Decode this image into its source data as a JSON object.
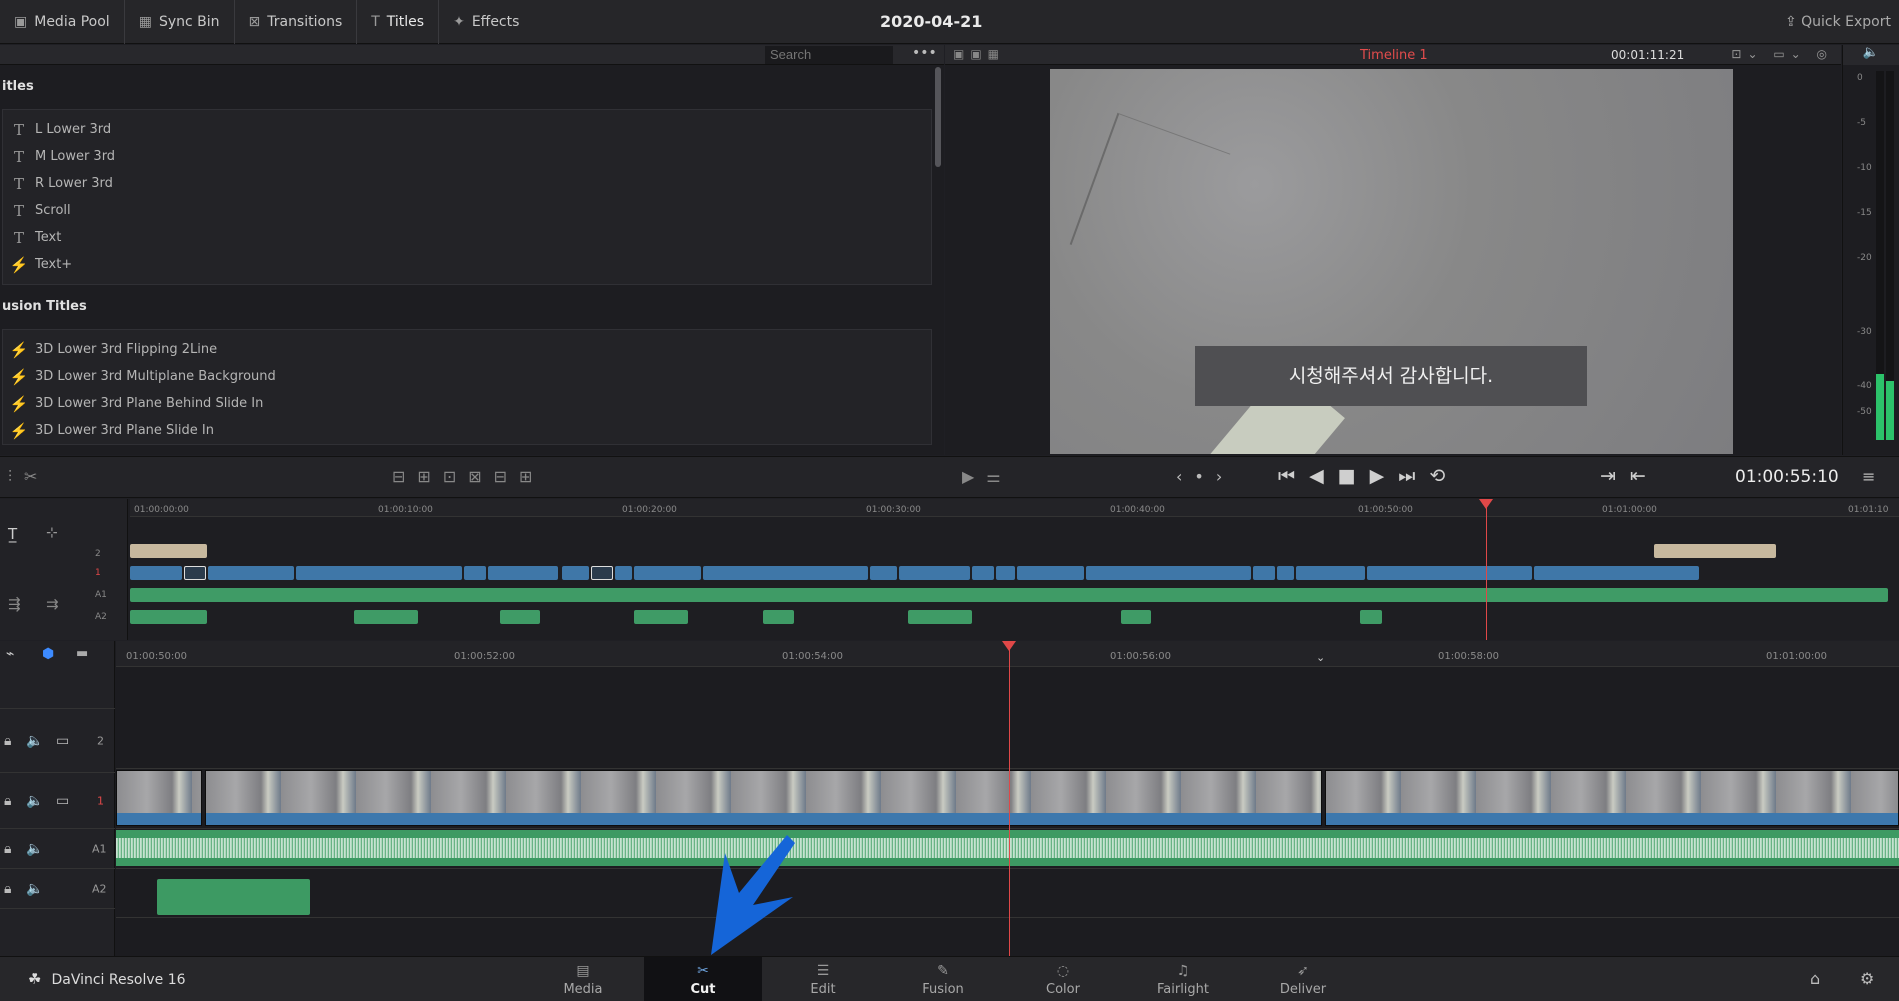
{
  "topbar": {
    "items": [
      {
        "label": "Media Pool",
        "icon": "media-pool-icon",
        "glyph": "▣"
      },
      {
        "label": "Sync Bin",
        "icon": "sync-bin-icon",
        "glyph": "▦"
      },
      {
        "label": "Transitions",
        "icon": "transitions-icon",
        "glyph": "⊠"
      },
      {
        "label": "Titles",
        "icon": "titles-icon",
        "glyph": "T"
      },
      {
        "label": "Effects",
        "icon": "effects-icon",
        "glyph": "✦"
      }
    ],
    "project_title": "2020-04-21",
    "quick_export": "Quick Export"
  },
  "library": {
    "search_placeholder": "Search",
    "sections": [
      {
        "title": "itles",
        "items": [
          "L Lower 3rd",
          "M Lower 3rd",
          "R Lower 3rd",
          "Scroll",
          "Text",
          "Text+"
        ]
      },
      {
        "title": "usion Titles",
        "items": [
          "3D Lower 3rd Flipping 2Line",
          "3D Lower 3rd Multiplane Background",
          "3D Lower 3rd Plane Behind Slide In",
          "3D Lower 3rd Plane Slide In"
        ]
      }
    ]
  },
  "viewer": {
    "timeline_name": "Timeline 1",
    "duration": "00:01:11:21",
    "subtitle": "시청해주셔서 감사합니다.",
    "timecode": "01:00:55:10"
  },
  "meter": {
    "labels": [
      "0",
      "-5",
      "-10",
      "-15",
      "-20",
      "-30",
      "-40",
      "-50"
    ],
    "level_left": 0.18,
    "level_right": 0.16
  },
  "mini_timeline": {
    "ticks": [
      "01:00:00:00",
      "01:00:10:00",
      "01:00:20:00",
      "01:00:30:00",
      "01:00:40:00",
      "01:00:50:00",
      "01:01:00:00",
      "01:01:10"
    ],
    "track_labels": [
      "2",
      "1",
      "A1",
      "A2"
    ]
  },
  "timeline": {
    "ticks": [
      "01:00:50:00",
      "01:00:52:00",
      "01:00:54:00",
      "01:00:56:00",
      "01:00:58:00",
      "01:01:00:00"
    ],
    "tracks": [
      "2",
      "1",
      "A1",
      "A2"
    ]
  },
  "pages": {
    "app_name": "DaVinci Resolve 16",
    "items": [
      {
        "label": "Media",
        "icon": "media-page-icon",
        "glyph": "▤"
      },
      {
        "label": "Cut",
        "icon": "cut-page-icon",
        "glyph": "✂"
      },
      {
        "label": "Edit",
        "icon": "edit-page-icon",
        "glyph": "☰"
      },
      {
        "label": "Fusion",
        "icon": "fusion-page-icon",
        "glyph": "✎"
      },
      {
        "label": "Color",
        "icon": "color-page-icon",
        "glyph": "◌"
      },
      {
        "label": "Fairlight",
        "icon": "fairlight-page-icon",
        "glyph": "♫"
      },
      {
        "label": "Deliver",
        "icon": "deliver-page-icon",
        "glyph": "➶"
      }
    ],
    "active": "Cut"
  },
  "colors": {
    "accent": "#3d78ad",
    "audio": "#3d9a63",
    "playhead": "#e04848",
    "annotation_arrow": "#1565d8"
  }
}
